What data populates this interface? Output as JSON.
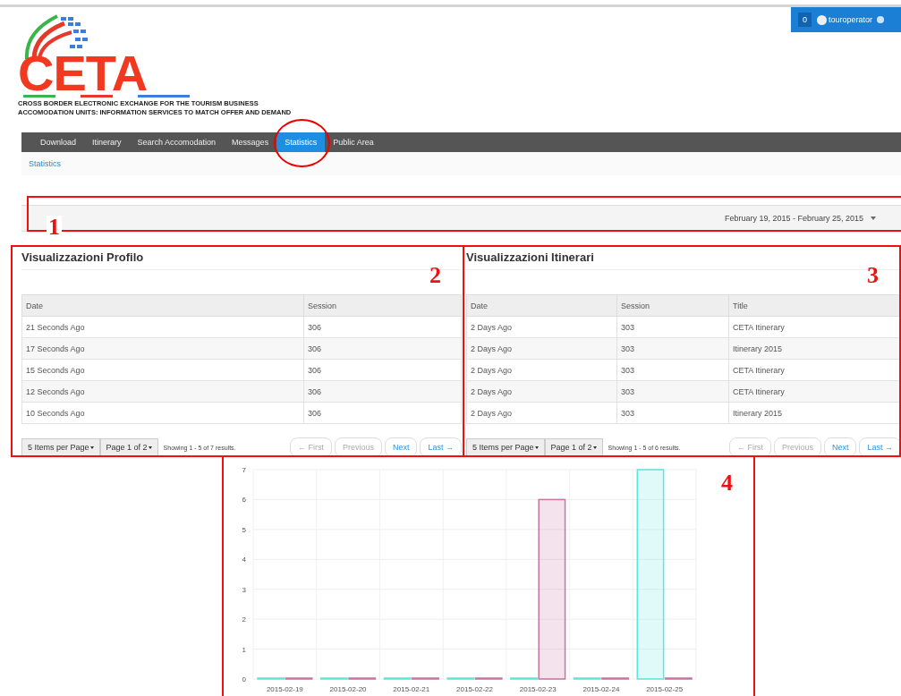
{
  "logo": {
    "wordmark": "CETA",
    "tagline": [
      "CROSS BORDER ELECTRONIC EXCHANGE FOR THE TOURISM BUSINESS",
      "ACCOMODATION UNITS: INFORMATION SERVICES TO MATCH OFFER AND DEMAND"
    ]
  },
  "user_bar": {
    "count": "0",
    "username": "touroperator"
  },
  "nav": [
    {
      "label": "Download",
      "selected": false
    },
    {
      "label": "Itinerary",
      "selected": false
    },
    {
      "label": "Search Accomodation",
      "selected": false
    },
    {
      "label": "Messages",
      "selected": false
    },
    {
      "label": "Statistics",
      "selected": true
    },
    {
      "label": "Public Area",
      "selected": false
    }
  ],
  "breadcrumb": "Statistics",
  "date_range": "February 19, 2015 - February 25, 2015",
  "panels": [
    {
      "title": "Visualizzazioni Profilo",
      "columns": [
        "Date",
        "Session"
      ],
      "rows": [
        [
          "21 Seconds Ago",
          "306"
        ],
        [
          "17 Seconds Ago",
          "306"
        ],
        [
          "15 Seconds Ago",
          "306"
        ],
        [
          "12 Seconds Ago",
          "306"
        ],
        [
          "10 Seconds Ago",
          "306"
        ]
      ],
      "pager": {
        "per_page": "5 Items per Page",
        "page": "Page 1 of 2",
        "summary": "Showing 1 - 5 of 7 results.",
        "buttons": [
          {
            "label": "← First",
            "disabled": true
          },
          {
            "label": "Previous",
            "disabled": true
          },
          {
            "label": "Next",
            "disabled": false
          },
          {
            "label": "Last →",
            "disabled": false
          }
        ]
      }
    },
    {
      "title": "Visualizzazioni Itinerari",
      "columns": [
        "Date",
        "Session",
        "Title"
      ],
      "rows": [
        [
          "2 Days Ago",
          "303",
          "CETA Itinerary"
        ],
        [
          "2 Days Ago",
          "303",
          "Itinerary 2015"
        ],
        [
          "2 Days Ago",
          "303",
          "CETA Itinerary"
        ],
        [
          "2 Days Ago",
          "303",
          "CETA Itinerary"
        ],
        [
          "2 Days Ago",
          "303",
          "Itinerary 2015"
        ]
      ],
      "pager": {
        "per_page": "5 Items per Page",
        "page": "Page 1 of 2",
        "summary": "Showing 1 - 5 of 6 results.",
        "buttons": [
          {
            "label": "← First",
            "disabled": true
          },
          {
            "label": "Previous",
            "disabled": true
          },
          {
            "label": "Next",
            "disabled": false
          },
          {
            "label": "Last →",
            "disabled": false
          }
        ]
      }
    }
  ],
  "chart_data": {
    "type": "bar",
    "categories": [
      "2015-02-19",
      "2015-02-20",
      "2015-02-21",
      "2015-02-22",
      "2015-02-23",
      "2015-02-24",
      "2015-02-25"
    ],
    "series": [
      {
        "color": "#5ee6da",
        "values": [
          0,
          0,
          0,
          0,
          0,
          0,
          7
        ]
      },
      {
        "color": "#c873a4",
        "values": [
          0,
          0,
          0,
          0,
          6,
          0,
          0
        ]
      }
    ],
    "ylim": [
      0,
      7
    ],
    "grid": true,
    "yticks": [
      0,
      1,
      2,
      3,
      4,
      5,
      6,
      7
    ]
  },
  "annotations": [
    "1",
    "2",
    "3",
    "4"
  ]
}
